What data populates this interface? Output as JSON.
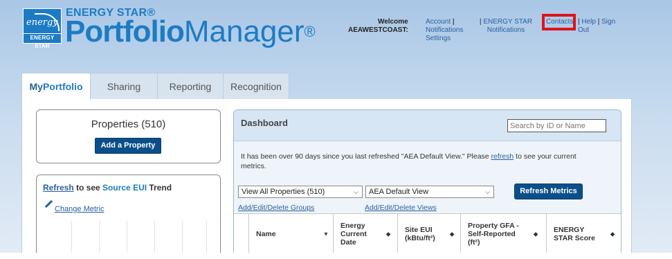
{
  "header": {
    "logo_text": "ENERGY STAR",
    "logo_script": "energy",
    "brand_top": "ENERGY STAR®",
    "brand_bold": "Portfolio",
    "brand_light": "Manager",
    "brand_reg": "®",
    "welcome_label": "Welcome",
    "username": "AEAWESTCOAST:",
    "account_link": "Account",
    "settings_link": "Settings",
    "notifications_link": "Notifications",
    "energy_star_notifications_link": "ENERGY STAR Notifications",
    "contacts_link": "Contacts",
    "help_link": "Help",
    "signout_link": "Sign Out",
    "separator": "|"
  },
  "tabs": [
    {
      "label_a": "My",
      "label_b": "Portfolio",
      "active": true
    },
    {
      "label": "Sharing"
    },
    {
      "label": "Reporting"
    },
    {
      "label": "Recognition"
    }
  ],
  "properties": {
    "title": "Properties (510)",
    "add_button": "Add a Property"
  },
  "trend": {
    "refresh_link": "Refresh",
    "middle": " to see ",
    "metric": "Source EUI",
    "end": " Trend",
    "change_metric": "Change Metric"
  },
  "dashboard": {
    "title": "Dashboard",
    "search_placeholder": "Search by ID or Name",
    "notice_a": "It has been over 90 days since you last refreshed \"AEA Default View.\" Please ",
    "notice_link": "refresh",
    "notice_b": " to see your current metrics.",
    "filter_select": "View All Properties (510)",
    "view_select": "AEA Default View",
    "refresh_button": "Refresh Metrics",
    "groups_link": "Add/Edit/Delete Groups",
    "views_link": "Add/Edit/Delete Views",
    "columns": [
      {
        "l1": "Name",
        "l2": "",
        "l3": "",
        "sort": "▼"
      },
      {
        "l1": "Energy",
        "l2": "Current",
        "l3": "Date",
        "sort": "◆"
      },
      {
        "l1": "Site EUI",
        "l2": "(kBtu/ft²)",
        "l3": "",
        "sort": "◆"
      },
      {
        "l1": "Property GFA -",
        "l2": "Self-Reported",
        "l3": "(ft²)",
        "sort": "◆"
      },
      {
        "l1": "ENERGY",
        "l2": "STAR Score",
        "l3": "",
        "sort": "◆"
      }
    ]
  },
  "colors": {
    "brand_blue": "#1d7bc4",
    "button_navy": "#0b4f8a",
    "link_blue": "#2a5f9e",
    "highlight_red": "#e0131b"
  }
}
